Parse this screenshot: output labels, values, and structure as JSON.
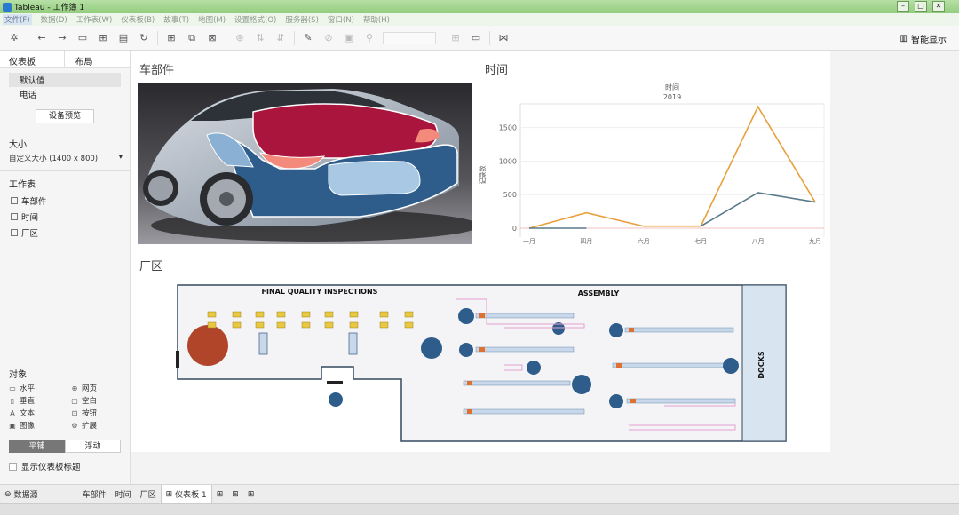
{
  "window": {
    "title": "Tableau - 工作簿 1"
  },
  "menu": [
    "文件(F)",
    "数据(D)",
    "工作表(W)",
    "仪表板(B)",
    "故事(T)",
    "地图(M)",
    "设置格式(O)",
    "服务器(S)",
    "窗口(N)",
    "帮助(H)"
  ],
  "toolbar": {
    "smart_show": "智能显示"
  },
  "left_pane": {
    "tab_dashboard": "仪表板",
    "tab_layout": "布局",
    "devices": [
      "默认值",
      "电话"
    ],
    "device_preview_button": "设备预览",
    "size_heading": "大小",
    "size_value": "自定义大小 (1400 x 800)",
    "sheets_heading": "工作表",
    "sheets": [
      "车部件",
      "时间",
      "厂区"
    ],
    "objects_heading": "对象",
    "objects": [
      {
        "label": "水平",
        "icon": "horizontal-icon"
      },
      {
        "label": "网页",
        "icon": "web-icon"
      },
      {
        "label": "垂直",
        "icon": "vertical-icon"
      },
      {
        "label": "空白",
        "icon": "blank-icon"
      },
      {
        "label": "文本",
        "icon": "text-icon"
      },
      {
        "label": "按钮",
        "icon": "button-icon"
      },
      {
        "label": "图像",
        "icon": "image-icon"
      },
      {
        "label": "扩展",
        "icon": "extension-icon"
      }
    ],
    "mode_tiled": "平铺",
    "mode_floating": "浮动",
    "show_dashboard_title": "显示仪表板标题"
  },
  "dashboard": {
    "car_title": "车部件",
    "time_title": "时间",
    "factory_title": "厂区",
    "factory": {
      "final_quality_label": "FINAL QUALITY INSPECTIONS",
      "assembly_label": "ASSEMBLY",
      "docks_label": "DOCKS"
    }
  },
  "chart_data": {
    "type": "line",
    "header": "时间",
    "subheader": "2019",
    "ylabel": "记录数",
    "categories": [
      "一月",
      "四月",
      "六月",
      "七月",
      "八月",
      "九月"
    ],
    "ylim": [
      0,
      1800
    ],
    "yticks": [
      0,
      500,
      1000,
      1500
    ],
    "series": [
      {
        "color": "#e8a03c",
        "values": [
          0,
          230,
          30,
          30,
          1810,
          390
        ]
      },
      {
        "color": "#5a7a8c",
        "values": [
          0,
          0,
          null,
          30,
          530,
          390
        ]
      }
    ],
    "grid": true
  },
  "bottom_tabs": {
    "datasource": "数据源",
    "sheets": [
      "车部件",
      "时间",
      "厂区"
    ],
    "active": "仪表板 1"
  }
}
